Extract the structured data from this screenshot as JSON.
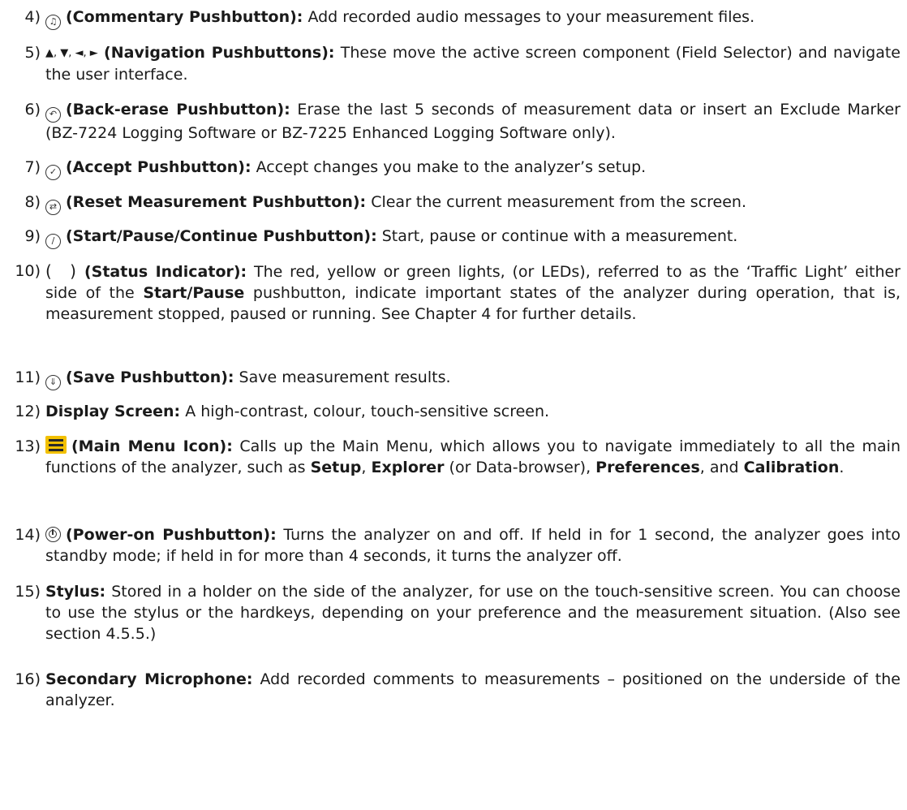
{
  "items": [
    {
      "num": "4)",
      "title": "(Commentary Pushbutton):",
      "text": " Add recorded audio messages to your measurement files.",
      "icon": "commentary-icon"
    },
    {
      "num": "5)",
      "title": "(Navigation Pushbuttons):",
      "text": " These move the active screen component (Field Selector) and navigate the user interface.",
      "icon": "navigation-arrows-icon",
      "glyphs": "▲, ▼, ◄, ►"
    },
    {
      "num": "6)",
      "title": "(Back-erase Pushbutton):",
      "text": " Erase the last 5 seconds of measurement data or insert an Exclude Marker (BZ-7224 Logging Software or BZ-7225 Enhanced Logging Software only).",
      "icon": "back-erase-icon"
    },
    {
      "num": "7)",
      "title": "(Accept Pushbutton):",
      "text": " Accept changes you make to the analyzer’s setup.",
      "icon": "accept-icon"
    },
    {
      "num": "8)",
      "title": "(Reset Measurement Pushbutton):",
      "text": " Clear the current measurement from the screen.",
      "icon": "reset-icon"
    },
    {
      "num": "9)",
      "title": "(Start/Pause/Continue Pushbutton):",
      "text": " Start, pause or continue with a measurement.",
      "icon": "start-pause-icon"
    },
    {
      "num": "10)",
      "title": "(Status Indicator):",
      "text_pre": " The red, yellow or green lights, (or LEDs), referred to as the ‘Traffic Light’ either side of the ",
      "bold_mid": "Start/Pause",
      "text_post": " pushbutton, indicate important states of the analyzer during operation, that is, measurement stopped, paused or running. See Chapter 4 for further details.",
      "icon": "status-indicator-icon",
      "glyphs": "( )"
    },
    {
      "num": "11)",
      "title": "(Save Pushbutton):",
      "text": " Save measurement results.",
      "icon": "save-icon"
    },
    {
      "num": "12)",
      "title": "Display Screen:",
      "text": " A high-contrast, colour, touch-sensitive screen."
    },
    {
      "num": "13)",
      "title": "(Main Menu Icon):",
      "text_pre": " Calls up the Main Menu, which allows you to navigate immediately to all the main functions of the analyzer, such as ",
      "b1": "Setup",
      "t1": ", ",
      "b2": "Explorer",
      "t2": " (or Data-browser), ",
      "b3": "Preferences",
      "t3": ", and ",
      "b4": "Calibration",
      "t4": ".",
      "icon": "main-menu-icon",
      "icon_color": "#f2c000"
    },
    {
      "num": "14)",
      "title": "(Power-on Pushbutton):",
      "text": " Turns the analyzer on and off. If held in for 1 second, the analyzer goes into standby mode; if held in for more than 4 seconds, it turns the analyzer off.",
      "icon": "power-icon"
    },
    {
      "num": "15)",
      "title": "Stylus:",
      "text": " Stored in a holder on the side of the analyzer, for use on the touch-sensitive screen. You can choose to use the stylus or the hardkeys, depending on your preference and the measurement situation. (Also see section 4.5.5.)"
    },
    {
      "num": "16)",
      "title": "Secondary Microphone:",
      "text": " Add recorded comments to measurements – positioned on the underside of the analyzer."
    }
  ]
}
